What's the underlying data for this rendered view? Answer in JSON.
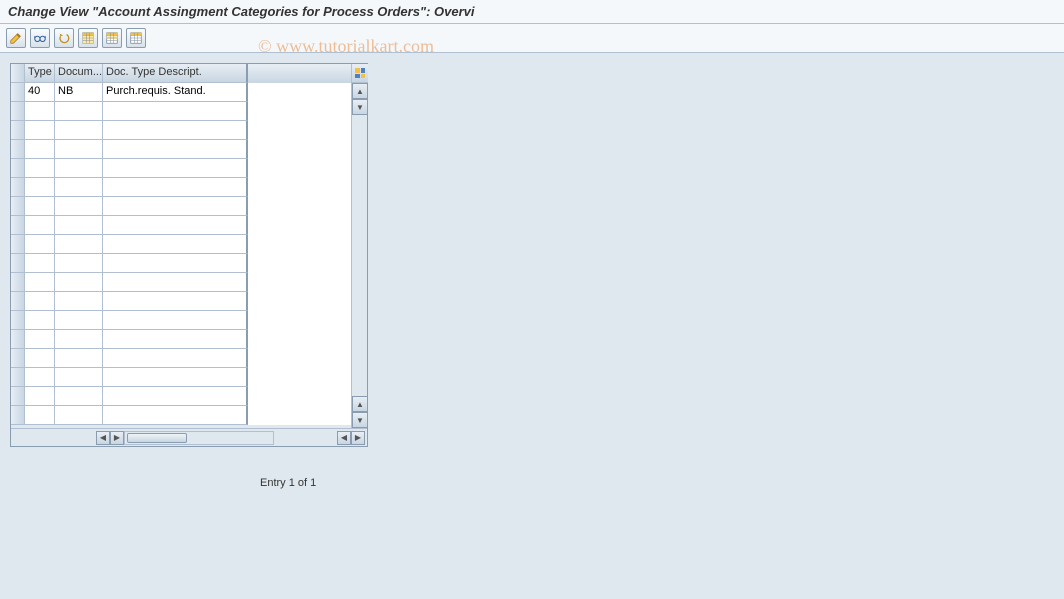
{
  "title": "Change View \"Account Assingment Categories for Process Orders\": Overvi",
  "watermark": "© www.tutorialkart.com",
  "toolbar": {
    "icons": [
      "display-change",
      "glasses",
      "undo",
      "save-row",
      "save-all",
      "delete-row"
    ]
  },
  "table": {
    "columns": [
      "Type",
      "Docum...",
      "Doc. Type Descript."
    ],
    "rows": [
      {
        "type": "40",
        "doc": "NB",
        "desc": "Purch.requis. Stand."
      }
    ],
    "empty_rows": 17
  },
  "status": "Entry 1 of 1"
}
